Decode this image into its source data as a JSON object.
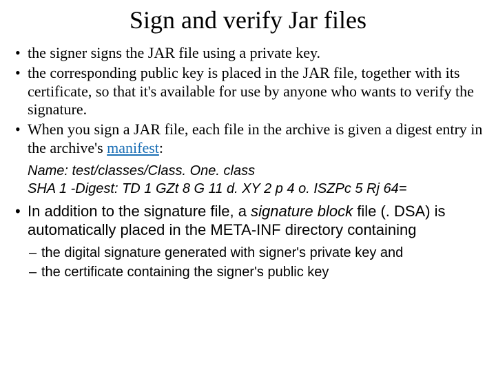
{
  "title": "Sign and verify Jar files",
  "bullets": {
    "b1": "the signer signs the JAR file using a private key.",
    "b2": "the corresponding public key is placed in the JAR file, together with its certificate, so that it's available for use by anyone who wants to verify the signature.",
    "b3_pre": "When you sign a JAR file, each file in the archive is given a digest entry in the archive's ",
    "b3_link": "manifest",
    "b3_post": ":",
    "b4_pre": "In addition to the signature file, a ",
    "b4_em": "signature block",
    "b4_post": " file (. DSA) is automatically placed in the META-INF directory containing"
  },
  "code": {
    "line1": "Name: test/classes/Class. One. class",
    "line2": "SHA 1 -Digest: TD 1 GZt 8 G 11 d. XY 2 p 4 o. ISZPc 5 Rj 64="
  },
  "sub": {
    "s1": "the digital signature generated with signer's private key and",
    "s2": "the certificate containing the signer's public key"
  }
}
